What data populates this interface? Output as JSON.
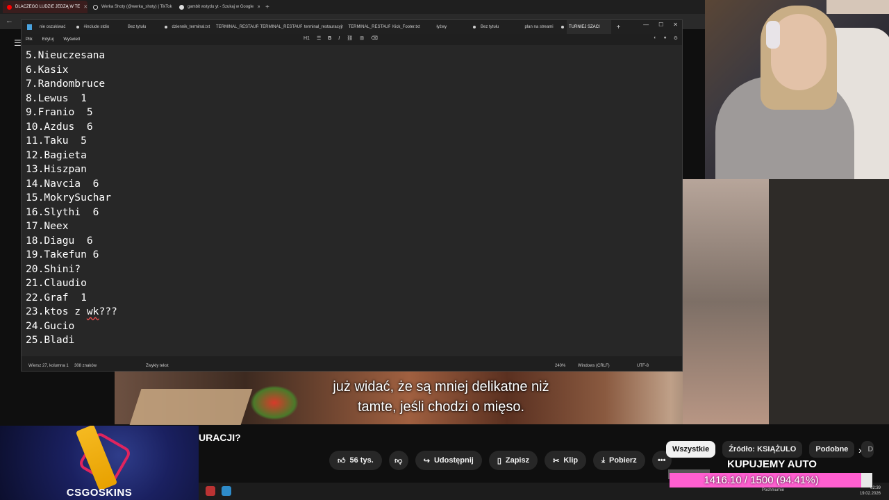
{
  "browser": {
    "tabs": [
      {
        "title": "DLACZEGO LUDZIE JEDZĄ W TE",
        "active": true,
        "icon": "youtube-icon",
        "color": "#ff0000"
      },
      {
        "title": "Werka Shoty (@werka_shoty) | TikTok",
        "active": false,
        "icon": "tiktok-icon",
        "color": "#ffffff"
      },
      {
        "title": "gambit wstydu yt - Szukaj w Google",
        "active": false,
        "icon": "google-icon",
        "color": "#dddddd"
      }
    ]
  },
  "notepad": {
    "tabs": [
      {
        "title": "nie oszukiwać",
        "modified": true
      },
      {
        "title": "#include stdio",
        "modified": false
      },
      {
        "title": "Bez tytułu",
        "modified": true
      },
      {
        "title": "dziennik_terminal.txt",
        "modified": false
      },
      {
        "title": "TERMINAL_RESTAUR",
        "modified": false
      },
      {
        "title": "TERMINAL_RESTAUR",
        "modified": false
      },
      {
        "title": "terminal_restauracyjr",
        "modified": false
      },
      {
        "title": "TERMINAL_RESTAUR",
        "modified": false
      },
      {
        "title": "Kick_Footer.txt",
        "modified": false
      },
      {
        "title": "łyżwy",
        "modified": true
      },
      {
        "title": "Bez tytułu",
        "modified": false
      },
      {
        "title": "plan na streami",
        "modified": true
      },
      {
        "title": "TURNIEJ SZACI",
        "modified": false,
        "active": true
      }
    ],
    "menu": {
      "file": "Plik",
      "edit": "Edytuj",
      "view": "Wyświetl"
    },
    "format": {
      "heading": "H1"
    },
    "lines": [
      "5.Nieuczesana",
      "6.Kasix",
      "7.Randombruce",
      "8.Lewus  1",
      "9.Franio  5",
      "10.Azdus  6",
      "11.Taku  5",
      "12.Bagieta",
      "13.Hiszpan",
      "14.Navcia  6",
      "15.MokrySuchar",
      "16.Slythi  6",
      "17.Neex",
      "18.Diagu  6",
      "19.Takefun 6",
      "20.Shini?",
      "21.Claudio",
      "22.Graf  1",
      "23.ktos z wk???",
      "24.Gucio",
      "25.Bladi"
    ],
    "status": {
      "position": "Wiersz 27, kolumna 1",
      "chars": "308 znaków",
      "mode": "Zwykły tekst",
      "zoom": "240%",
      "line_ending": "Windows (CRLF)",
      "encoding": "UTF-8"
    }
  },
  "video": {
    "subtitle_line1": "już widać, że są mniej delikatne niż",
    "subtitle_line2": "tamte, jeśli chodzi o mięso.",
    "title_fragment": "URACJI?",
    "actions": {
      "likes": "56 tys.",
      "share": "Udostępnij",
      "save": "Zapisz",
      "clip": "Klip",
      "download": "Pobierz"
    },
    "chips": [
      "Wszystkie",
      "Źródło: KSIĄŻULO",
      "Podobne",
      "D"
    ]
  },
  "ad": {
    "brand": "CSGOSKINS"
  },
  "goal": {
    "title": "KUPUJEMY AUTO",
    "text": "1416.10 / 1500 (94.41%)",
    "progress": 0.9441,
    "fill_color": "#ff5fd0"
  },
  "taskbar": {
    "weather": "Pochmurnie",
    "time": "02:39",
    "date": "19.02.2026"
  }
}
